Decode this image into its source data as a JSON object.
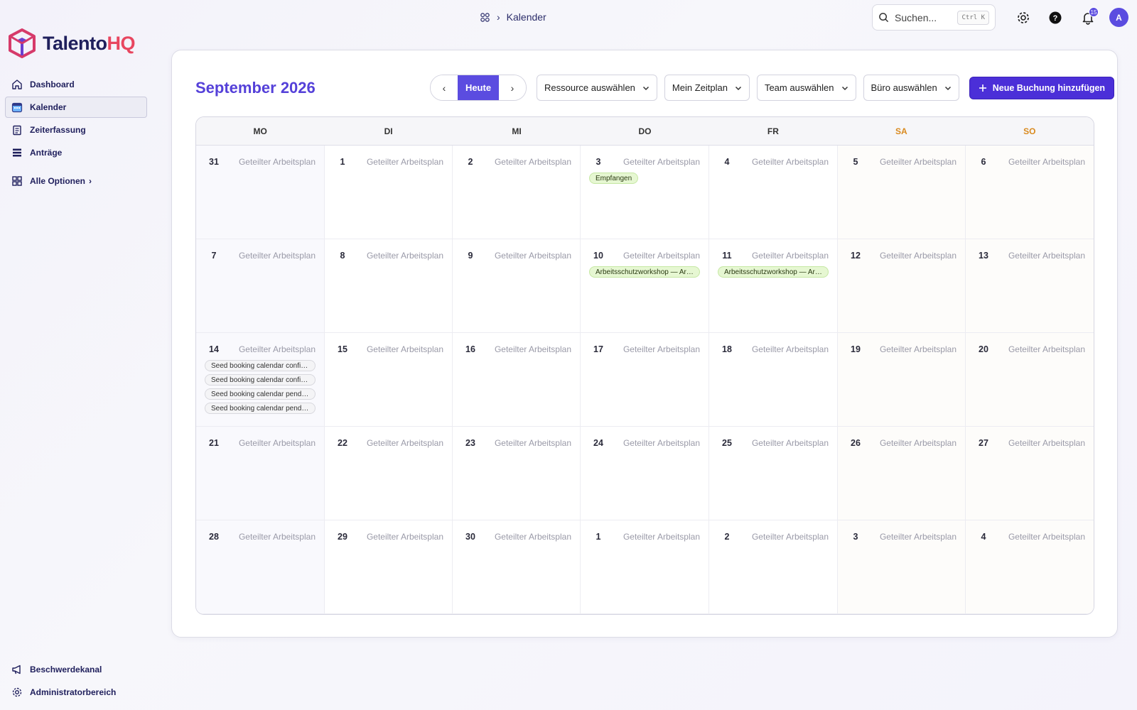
{
  "app": {
    "logo_part1": "Talento",
    "logo_part2": "HQ"
  },
  "sidebar": {
    "items": [
      {
        "label": "Dashboard",
        "icon": "home-icon"
      },
      {
        "label": "Kalender",
        "icon": "calendar-icon",
        "active": true
      },
      {
        "label": "Zeiterfassung",
        "icon": "clipboard-icon"
      },
      {
        "label": "Anträge",
        "icon": "stack-icon"
      }
    ],
    "more_label": "Alle Optionen",
    "bottom": [
      {
        "label": "Beschwerdekanal",
        "icon": "megaphone-icon"
      },
      {
        "label": "Administratorbereich",
        "icon": "gear-icon"
      }
    ]
  },
  "header": {
    "breadcrumb": "Kalender",
    "search_placeholder": "Suchen...",
    "search_shortcut": "Ctrl K",
    "notification_count": "15",
    "avatar_initial": "A"
  },
  "toolbar": {
    "month_title": "September 2026",
    "today_label": "Heute",
    "resource_select": "Ressource auswählen",
    "schedule_select": "Mein Zeitplan",
    "team_select": "Team auswählen",
    "office_select": "Büro auswählen",
    "add_booking_label": "Neue Buchung hinzufügen"
  },
  "colors": {
    "accent": "#5b4ce0",
    "title": "#5541d9",
    "weekend": "#d98a1f",
    "event_green": "#e6f7d2"
  },
  "calendar": {
    "weekdays": [
      "MO",
      "DI",
      "MI",
      "DO",
      "FR",
      "SA",
      "SO"
    ],
    "schedule_label": "Geteilter Arbeitsplan",
    "days": [
      {
        "n": "31",
        "events": []
      },
      {
        "n": "1",
        "events": []
      },
      {
        "n": "2",
        "events": []
      },
      {
        "n": "3",
        "events": [
          {
            "t": "Empfangen",
            "c": "green"
          }
        ]
      },
      {
        "n": "4",
        "events": []
      },
      {
        "n": "5",
        "events": []
      },
      {
        "n": "6",
        "events": []
      },
      {
        "n": "7",
        "events": []
      },
      {
        "n": "8",
        "events": []
      },
      {
        "n": "9",
        "events": []
      },
      {
        "n": "10",
        "events": [
          {
            "t": "Arbeitsschutzworkshop — Arbeitsschutzworkshop",
            "c": "green"
          }
        ]
      },
      {
        "n": "11",
        "events": [
          {
            "t": "Arbeitsschutzworkshop — Arbeitsschutzworkshop",
            "c": "green"
          }
        ]
      },
      {
        "n": "12",
        "events": []
      },
      {
        "n": "13",
        "events": []
      },
      {
        "n": "14",
        "events": [
          {
            "t": "Seed booking calendar confirmed",
            "c": "gray"
          },
          {
            "t": "Seed booking calendar confirmed",
            "c": "gray"
          },
          {
            "t": "Seed booking calendar pending",
            "c": "gray"
          },
          {
            "t": "Seed booking calendar pending",
            "c": "gray"
          }
        ]
      },
      {
        "n": "15",
        "events": []
      },
      {
        "n": "16",
        "events": []
      },
      {
        "n": "17",
        "events": []
      },
      {
        "n": "18",
        "events": []
      },
      {
        "n": "19",
        "events": []
      },
      {
        "n": "20",
        "events": []
      },
      {
        "n": "21",
        "events": []
      },
      {
        "n": "22",
        "events": []
      },
      {
        "n": "23",
        "events": []
      },
      {
        "n": "24",
        "events": []
      },
      {
        "n": "25",
        "events": []
      },
      {
        "n": "26",
        "events": []
      },
      {
        "n": "27",
        "events": []
      },
      {
        "n": "28",
        "events": []
      },
      {
        "n": "29",
        "events": []
      },
      {
        "n": "30",
        "events": []
      },
      {
        "n": "1",
        "events": []
      },
      {
        "n": "2",
        "events": []
      },
      {
        "n": "3",
        "events": []
      },
      {
        "n": "4",
        "events": []
      }
    ]
  }
}
